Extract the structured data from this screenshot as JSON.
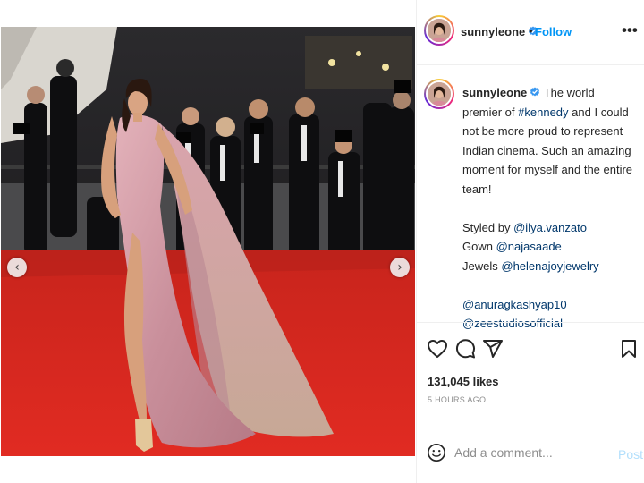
{
  "post": {
    "username": "sunnyleone",
    "follow_separator": "•",
    "follow_label": "Follow",
    "more_label": "•••",
    "caption": {
      "username": "sunnyleone",
      "text_before_tag": "The world premier of",
      "hashtag": "#kennedy",
      "text_after_tag": "and I could not be more proud to represent Indian cinema. Such an amazing moment for myself and the entire team!",
      "styled_by_label": "Styled by",
      "styled_by_handle": "@ilya.vanzato",
      "gown_label": "Gown",
      "gown_handle": "@najasaade",
      "jewels_label": "Jewels",
      "jewels_handle": "@helenajoyjewelry",
      "mention_1": "@anuragkashyap10",
      "mention_2": "@zeestudiosofficial"
    },
    "likes": "131,045 likes",
    "time_ago": "5 HOURS AGO",
    "comment_placeholder": "Add a comment...",
    "post_button": "Post",
    "carousel": {
      "prev": "‹",
      "next": "›",
      "slides": 2,
      "active_slide": 2
    }
  },
  "icons": [
    "verified-badge-icon",
    "heart-icon",
    "comment-icon",
    "share-icon",
    "bookmark-icon",
    "emoji-icon",
    "chevron-left-icon",
    "chevron-right-icon"
  ],
  "colors": {
    "link": "#00376b",
    "follow": "#0095f6",
    "post_disabled": "#b2dffc",
    "red_carpet": "#d8261f"
  }
}
